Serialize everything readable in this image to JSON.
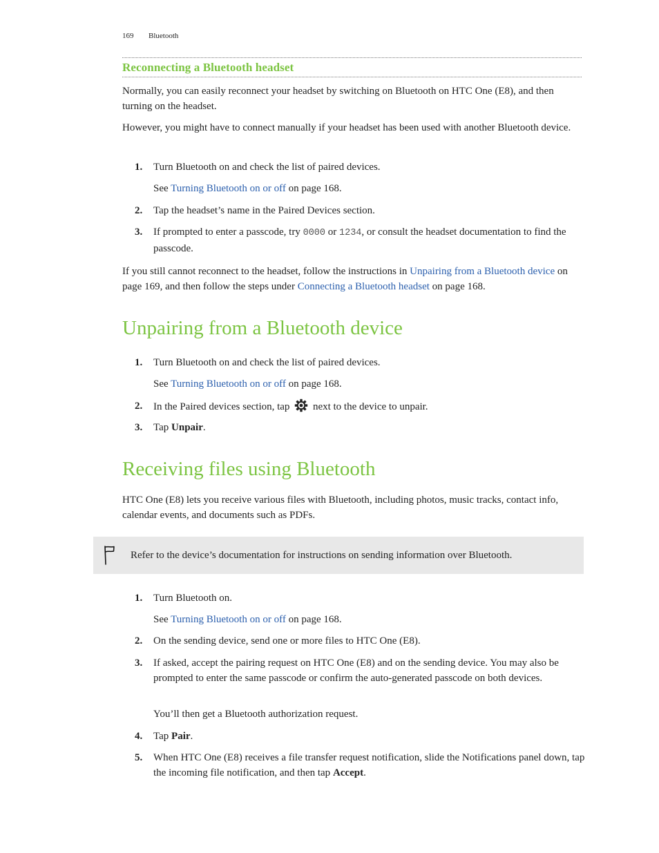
{
  "header": {
    "page_number": "169",
    "section": "Bluetooth"
  },
  "reconnect": {
    "title": "Reconnecting a Bluetooth headset",
    "para1": "Normally, you can easily reconnect your headset by switching on Bluetooth on HTC One (E8), and then turning on the headset.",
    "para2": "However, you might have to connect manually if your headset has been used with another Bluetooth device.",
    "steps": [
      {
        "num": "1.",
        "text": "Turn Bluetooth on and check the list of paired devices.",
        "see_prefix": "See ",
        "see_link": "Turning Bluetooth on or off",
        "see_suffix": " on page 168."
      },
      {
        "num": "2.",
        "text": "Tap the headset’s name in the Paired Devices section."
      },
      {
        "num": "3.",
        "text_a": "If prompted to enter a passcode, try ",
        "code1": "0000",
        "text_b": " or ",
        "code2": "1234",
        "text_c": ", or consult the headset documentation to find the passcode."
      }
    ],
    "outro_a": "If you still cannot reconnect to the headset, follow the instructions in ",
    "outro_link1": "Unpairing from a Bluetooth device",
    "outro_b": " on page 169, and then follow the steps under ",
    "outro_link2": "Connecting a Bluetooth headset",
    "outro_c": " on page 168."
  },
  "unpair": {
    "title": "Unpairing from a Bluetooth device",
    "steps": [
      {
        "num": "1.",
        "text": "Turn Bluetooth on and check the list of paired devices.",
        "see_prefix": "See ",
        "see_link": "Turning Bluetooth on or off",
        "see_suffix": " on page 168."
      },
      {
        "num": "2.",
        "text_a": "In the Paired devices section, tap ",
        "icon": "settings-gear-icon",
        "text_b": " next to the device to unpair."
      },
      {
        "num": "3.",
        "text_a": "Tap ",
        "bold": "Unpair",
        "text_b": "."
      }
    ]
  },
  "receive": {
    "title": "Receiving files using Bluetooth",
    "intro": "HTC One (E8) lets you receive various files with Bluetooth, including photos, music tracks, contact info, calendar events, and documents such as PDFs.",
    "note": {
      "icon": "flag-icon",
      "text": "Refer to the device’s documentation for instructions on sending information over Bluetooth."
    },
    "steps": [
      {
        "num": "1.",
        "text": "Turn Bluetooth on.",
        "see_prefix": "See ",
        "see_link": "Turning Bluetooth on or off",
        "see_suffix": " on page 168."
      },
      {
        "num": "2.",
        "text": "On the sending device, send one or more files to HTC One (E8)."
      },
      {
        "num": "3.",
        "text": "If asked, accept the pairing request on HTC One (E8) and on the sending device. You may also be prompted to enter the same passcode or confirm the auto-generated passcode on both devices.",
        "followup": "You’ll then get a Bluetooth authorization request."
      },
      {
        "num": "4.",
        "text_a": "Tap ",
        "bold": "Pair",
        "text_b": "."
      },
      {
        "num": "5.",
        "text_a": "When HTC One (E8) receives a file transfer request notification, slide the Notifications panel down, tap the incoming file notification, and then tap ",
        "bold": "Accept",
        "text_b": "."
      }
    ]
  },
  "colors": {
    "heading_green": "#7cc442",
    "link_blue": "#2b5fad",
    "note_bg": "#e8e8e8"
  }
}
